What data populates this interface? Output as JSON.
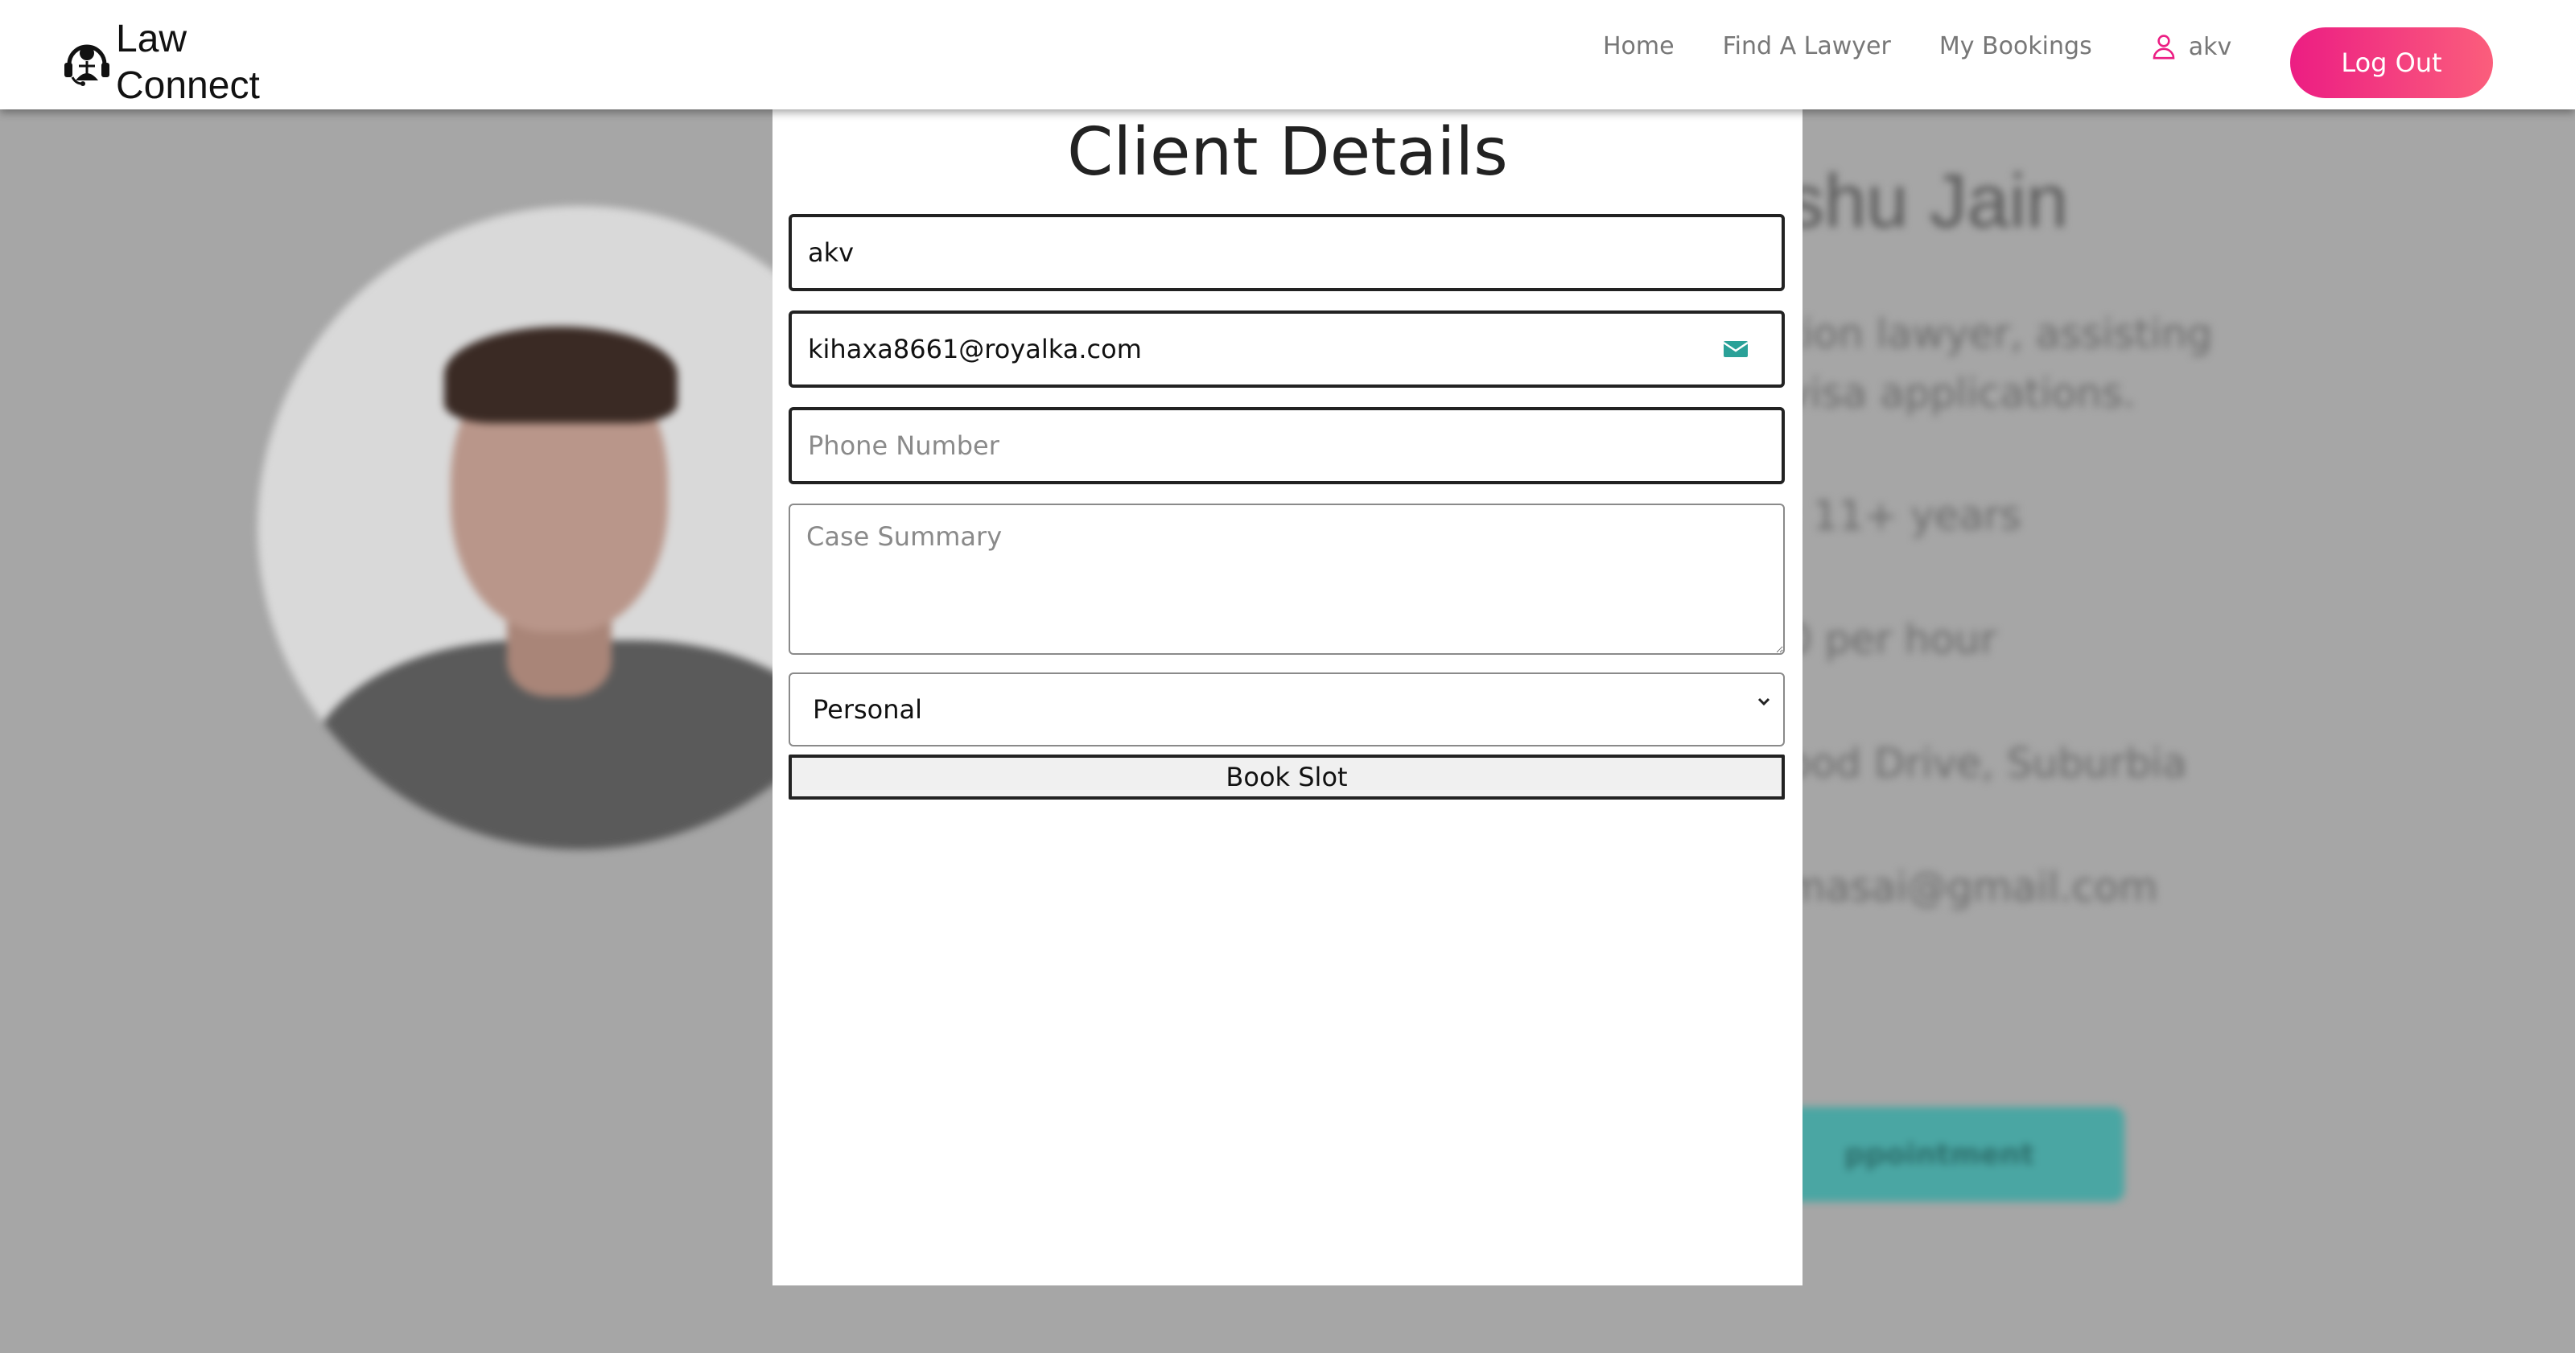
{
  "nav": {
    "logo_line1": "Law",
    "logo_line2": "Connect",
    "links": [
      "Home",
      "Find A Lawyer",
      "My Bookings"
    ],
    "user_name": "akv",
    "logout_label": "Log Out",
    "accent": "#ec1d83"
  },
  "background": {
    "name_visible": "shu Jain",
    "lines": [
      "tion lawyer, assisting",
      "visa applications.",
      ": 11+ years",
      "0 per hour",
      "ood Drive, Suburbia",
      "masai@gmail.com"
    ],
    "button_label": "ppointment"
  },
  "modal": {
    "title": "Client Details",
    "name_value": "akv",
    "email_value": "kihaxa8661@royalka.com",
    "phone_placeholder": "Phone Number",
    "summary_placeholder": "Case Summary",
    "select_value": "Personal",
    "book_label": "Book Slot"
  }
}
